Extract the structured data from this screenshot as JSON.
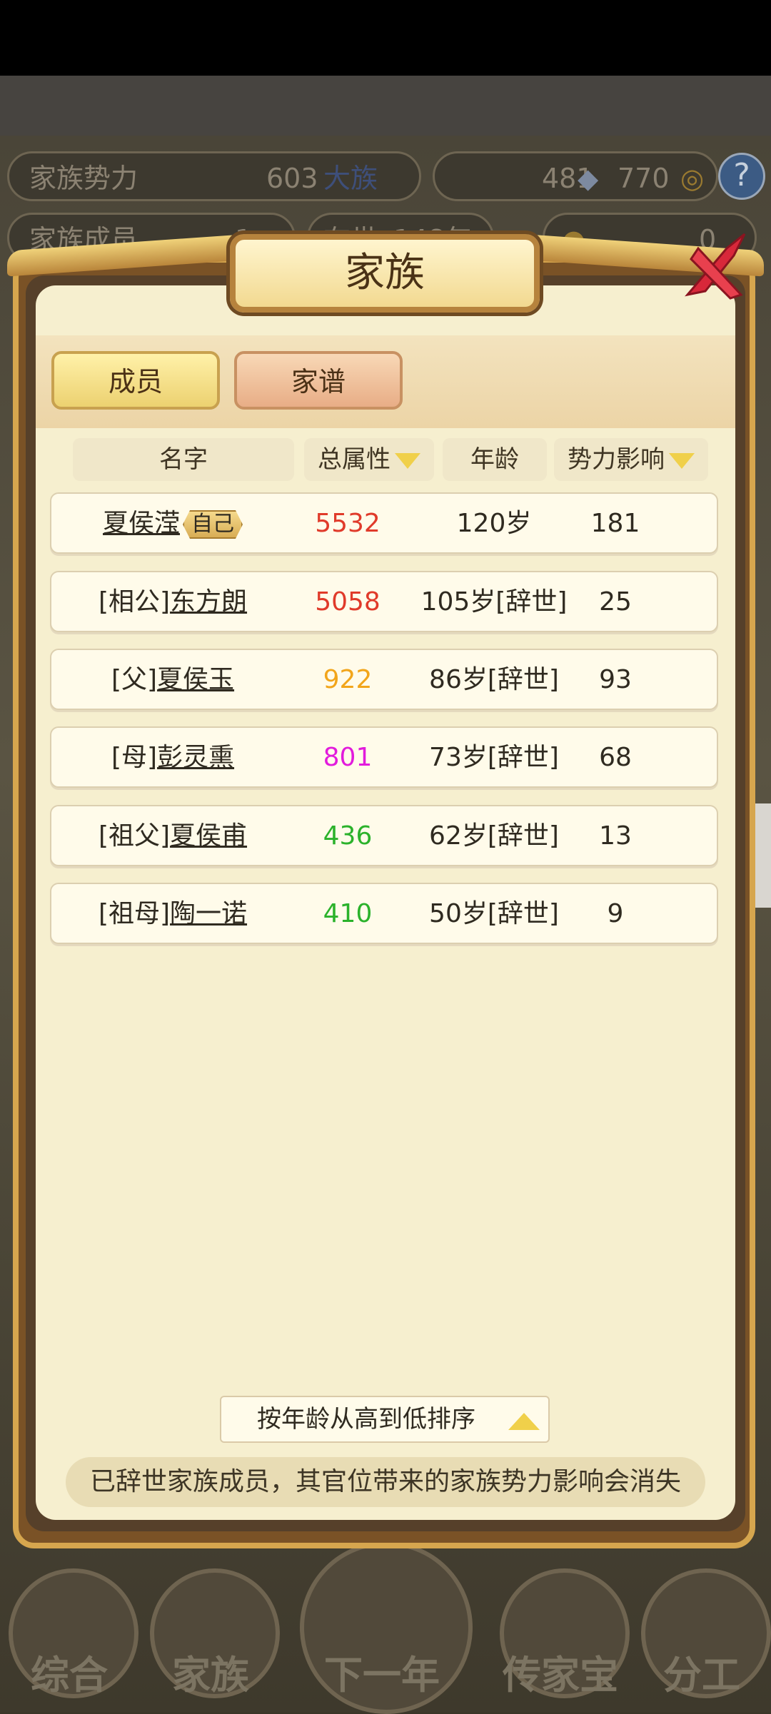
{
  "background": {
    "stat_bar_1": {
      "label": "家族势力",
      "value": "603",
      "tag": "大族",
      "silver": "481",
      "copper": "770"
    },
    "stat_bar_2": {
      "label": "家族成员",
      "count": "1",
      "age_label": "在世",
      "age_value": "148年",
      "gold": "0"
    },
    "help_label": "?"
  },
  "dialog": {
    "title": "家族",
    "tabs": [
      {
        "label": "成员",
        "active": true
      },
      {
        "label": "家谱",
        "active": false
      }
    ],
    "columns": [
      "名字",
      "总属性",
      "年龄",
      "势力影响"
    ],
    "members": [
      {
        "prefix": "",
        "name": "夏侯滢",
        "badge": "自己",
        "attr": "5532",
        "attr_color": "#e03a2a",
        "age": "120岁",
        "influence": "181"
      },
      {
        "prefix": "[相公]",
        "name": "东方朗",
        "badge": "",
        "attr": "5058",
        "attr_color": "#e03a2a",
        "age": "105岁[辞世]",
        "influence": "25"
      },
      {
        "prefix": "[父]",
        "name": "夏侯玉",
        "badge": "",
        "attr": "922",
        "attr_color": "#f2a51a",
        "age": "86岁[辞世]",
        "influence": "93"
      },
      {
        "prefix": "[母]",
        "name": "彭灵熏",
        "badge": "",
        "attr": "801",
        "attr_color": "#e21bdc",
        "age": "73岁[辞世]",
        "influence": "68"
      },
      {
        "prefix": "[祖父]",
        "name": "夏侯甫",
        "badge": "",
        "attr": "436",
        "attr_color": "#2bb22b",
        "age": "62岁[辞世]",
        "influence": "13"
      },
      {
        "prefix": "[祖母]",
        "name": "陶一诺",
        "badge": "",
        "attr": "410",
        "attr_color": "#2bb22b",
        "age": "50岁[辞世]",
        "influence": "9"
      }
    ],
    "sort_label": "按年龄从高到低排序",
    "notice": "已辞世家族成员，其官位带来的家族势力影响会消失"
  },
  "bottom_nav": [
    {
      "label": "综合",
      "icon": "scroll-icon"
    },
    {
      "label": "家族",
      "icon": "house-icon"
    },
    {
      "label": "下一年",
      "icon": "mountain-icon"
    },
    {
      "label": "传家宝",
      "icon": "jade-icon"
    },
    {
      "label": "分工",
      "icon": "people-icon"
    }
  ]
}
